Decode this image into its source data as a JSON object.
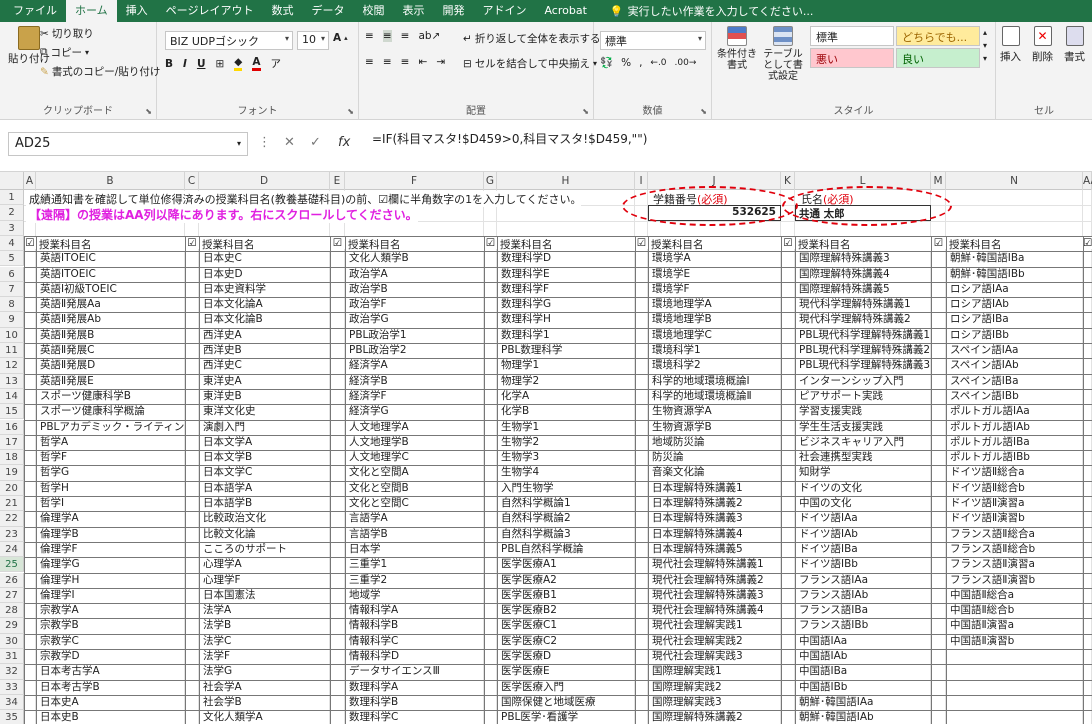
{
  "ribbon_tabs": [
    "ファイル",
    "ホーム",
    "挿入",
    "ページレイアウト",
    "数式",
    "データ",
    "校閲",
    "表示",
    "開発",
    "アドイン",
    "Acrobat"
  ],
  "active_tab": "ホーム",
  "tell_me": "実行したい作業を入力してください...",
  "clipboard": {
    "paste": "貼り付け",
    "cut": "切り取り",
    "copy": "コピー",
    "format_painter": "書式のコピー/貼り付け",
    "label": "クリップボード"
  },
  "font": {
    "name": "BIZ UDPゴシック",
    "size": "10",
    "label": "フォント"
  },
  "alignment": {
    "wrap": "折り返して全体を表示する",
    "merge": "セルを結合して中央揃え",
    "label": "配置"
  },
  "number": {
    "format": "標準",
    "label": "数値"
  },
  "styles": {
    "cond": "条件付き書式",
    "table": "テーブルとして書式設定",
    "normal": "標準",
    "neutral": "どちらでも...",
    "bad": "悪い",
    "good": "良い",
    "label": "スタイル"
  },
  "cells": {
    "insert": "挿入",
    "delete": "削除",
    "format": "書式",
    "label": "セル"
  },
  "name_box": "AD25",
  "formula": "=IF(科目マスタ!$D459>0,科目マスタ!$D459,\"\")",
  "columns": [
    "A",
    "B",
    "C",
    "D",
    "E",
    "F",
    "G",
    "H",
    "I",
    "J",
    "K",
    "L",
    "M",
    "N",
    "AA"
  ],
  "row_numbers": [
    "1",
    "2",
    "3",
    "4",
    "5",
    "6",
    "7",
    "8",
    "9",
    "10",
    "11",
    "12",
    "13",
    "14",
    "15",
    "16",
    "17",
    "18",
    "19",
    "20",
    "21",
    "22",
    "23",
    "24",
    "25",
    "26",
    "27",
    "28",
    "29",
    "30",
    "31",
    "32",
    "33",
    "34",
    "35"
  ],
  "selected_row": "25",
  "instruction": "成績通知書を確認して単位修得済みの授業科目名(教養基礎科目)の前、☑欄に半角数字の1を入力してください。",
  "notice": "【遠隔】の授業はAA列以降にあります。右にスクロールしてください。",
  "student_id_label": "学籍番号",
  "required_mark": "(必須)",
  "student_id": "532625",
  "name_label": "氏名",
  "name_value": "共通 太郎",
  "table_header": "授業科目名",
  "check_glyph": "☑",
  "colors": {
    "excel_green": "#217346",
    "notice": "#e020e0",
    "required": "#e0000c",
    "oval": "#e0000c"
  },
  "table": {
    "col1": [
      "英語ⅠTOEIC",
      "英語ⅠTOEIC",
      "英語Ⅰ初級TOEIC",
      "英語Ⅱ発展Aa",
      "英語Ⅱ発展Ab",
      "英語Ⅱ発展B",
      "英語Ⅱ発展C",
      "英語Ⅱ発展D",
      "英語Ⅱ発展E",
      "スポーツ健康科学B",
      "スポーツ健康科学概論",
      "PBLアカデミック・ライティング",
      "哲学A",
      "哲学F",
      "哲学G",
      "哲学H",
      "哲学I",
      "倫理学A",
      "倫理学B",
      "倫理学F",
      "倫理学G",
      "倫理学H",
      "倫理学I",
      "宗教学A",
      "宗教学B",
      "宗教学C",
      "宗教学D",
      "日本考古学A",
      "日本考古学B",
      "日本史A",
      "日本史B"
    ],
    "col2": [
      "日本史C",
      "日本史D",
      "日本史資料学",
      "日本文化論A",
      "日本文化論B",
      "西洋史A",
      "西洋史B",
      "西洋史C",
      "東洋史A",
      "東洋史B",
      "東洋文化史",
      "演劇入門",
      "日本文学A",
      "日本文学B",
      "日本文学C",
      "日本語学A",
      "日本語学B",
      "比較政治文化",
      "比較文化論",
      "こころのサポート",
      "心理学A",
      "心理学F",
      "日本国憲法",
      "法学A",
      "法学B",
      "法学C",
      "法学F",
      "法学G",
      "社会学A",
      "社会学B",
      "文化人類学A"
    ],
    "col3": [
      "文化人類学B",
      "政治学A",
      "政治学B",
      "政治学F",
      "政治学G",
      "PBL政治学1",
      "PBL政治学2",
      "経済学A",
      "経済学B",
      "経済学F",
      "経済学G",
      "人文地理学A",
      "人文地理学B",
      "人文地理学C",
      "文化と空間A",
      "文化と空間B",
      "文化と空間C",
      "言語学A",
      "言語学B",
      "日本学",
      "三重学1",
      "三重学2",
      "地域学",
      "情報科学A",
      "情報科学B",
      "情報科学C",
      "情報科学D",
      "データサイエンスⅢ",
      "数理科学A",
      "数理科学B",
      "数理科学C"
    ],
    "col4": [
      "数理科学D",
      "数理科学E",
      "数理科学F",
      "数理科学G",
      "数理科学H",
      "数理科学1",
      "PBL数理科学",
      "物理学1",
      "物理学2",
      "化学A",
      "化学B",
      "生物学1",
      "生物学2",
      "生物学3",
      "生物学4",
      "入門生物学",
      "自然科学概論1",
      "自然科学概論2",
      "自然科学概論3",
      "PBL自然科学概論",
      "医学医療A1",
      "医学医療A2",
      "医学医療B1",
      "医学医療B2",
      "医学医療C1",
      "医学医療C2",
      "医学医療D",
      "医学医療E",
      "医学医療入門",
      "国際保健と地域医療",
      "PBL医学･看護学"
    ],
    "col5": [
      "環境学A",
      "環境学E",
      "環境学F",
      "環境地理学A",
      "環境地理学B",
      "環境地理学C",
      "環境科学1",
      "環境科学2",
      "科学的地域環境概論Ⅰ",
      "科学的地域環境概論Ⅱ",
      "生物資源学A",
      "生物資源学B",
      "地域防災論",
      "防災論",
      "音楽文化論",
      "日本理解特殊講義1",
      "日本理解特殊講義2",
      "日本理解特殊講義3",
      "日本理解特殊講義4",
      "日本理解特殊講義5",
      "現代社会理解特殊講義1",
      "現代社会理解特殊講義2",
      "現代社会理解特殊講義3",
      "現代社会理解特殊講義4",
      "現代社会理解実践1",
      "現代社会理解実践2",
      "現代社会理解実践3",
      "国際理解実践1",
      "国際理解実践2",
      "国際理解実践3",
      "国際理解特殊講義2"
    ],
    "col6": [
      "国際理解特殊講義3",
      "国際理解特殊講義4",
      "国際理解特殊講義5",
      "現代科学理解特殊講義1",
      "現代科学理解特殊講義2",
      "PBL現代科学理解特殊講義1",
      "PBL現代科学理解特殊講義2",
      "PBL現代科学理解特殊講義3",
      "インターンシップ入門",
      "ピアサポート実践",
      "学習支援実践",
      "学生生活支援実践",
      "ビジネスキャリア入門",
      "社会連携型実践",
      "知財学",
      "ドイツの文化",
      "中国の文化",
      "ドイツ語ⅠAa",
      "ドイツ語ⅠAb",
      "ドイツ語ⅠBa",
      "ドイツ語ⅠBb",
      "フランス語ⅠAa",
      "フランス語ⅠAb",
      "フランス語ⅠBa",
      "フランス語ⅠBb",
      "中国語ⅠAa",
      "中国語ⅠAb",
      "中国語ⅠBa",
      "中国語ⅠBb",
      "朝鮮･韓国語ⅠAa",
      "朝鮮･韓国語ⅠAb"
    ],
    "col7": [
      "朝鮮･韓国語ⅠBa",
      "朝鮮･韓国語ⅠBb",
      "ロシア語ⅠAa",
      "ロシア語ⅠAb",
      "ロシア語ⅠBa",
      "ロシア語ⅠBb",
      "スペイン語ⅠAa",
      "スペイン語ⅠAb",
      "スペイン語ⅠBa",
      "スペイン語ⅠBb",
      "ポルトガル語ⅠAa",
      "ポルトガル語ⅠAb",
      "ポルトガル語ⅠBa",
      "ポルトガル語ⅠBb",
      "ドイツ語Ⅱ総合a",
      "ドイツ語Ⅱ総合b",
      "ドイツ語Ⅱ演習a",
      "ドイツ語Ⅱ演習b",
      "フランス語Ⅱ総合a",
      "フランス語Ⅱ総合b",
      "フランス語Ⅱ演習a",
      "フランス語Ⅱ演習b",
      "中国語Ⅱ総合a",
      "中国語Ⅱ総合b",
      "中国語Ⅱ演習a",
      "中国語Ⅱ演習b",
      "",
      "",
      "",
      "",
      ""
    ]
  }
}
